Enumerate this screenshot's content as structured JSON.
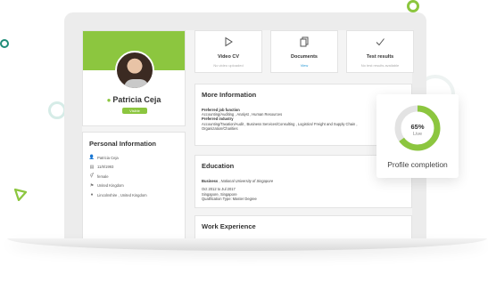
{
  "profile": {
    "name": "Patricia Ceja",
    "status": "Visible",
    "accent": "#8cc63f"
  },
  "personal": {
    "title": "Personal Information",
    "rows": [
      {
        "icon": "person-icon",
        "value": "Patricia Ceja"
      },
      {
        "icon": "calendar-icon",
        "value": "11/8/1993"
      },
      {
        "icon": "gender-icon",
        "value": "female"
      },
      {
        "icon": "flag-icon",
        "value": "United Kingdom"
      },
      {
        "icon": "location-pin-icon",
        "value": "Lincolnshire , United Kingdom"
      }
    ]
  },
  "tiles": {
    "video": {
      "label": "Video CV",
      "sub": "No video uploaded",
      "icon": "play-icon"
    },
    "documents": {
      "label": "Documents",
      "sub": "View",
      "icon": "documents-icon"
    },
    "tests": {
      "label": "Test results",
      "sub": "No test results available",
      "icon": "checkmark-icon"
    }
  },
  "more_info": {
    "title": "More Information",
    "job_function_label": "Preferred job function",
    "job_function_value": "Accounting/Auditing , Analyst , Human Resources",
    "industry_label": "Preferred industry",
    "industry_value": "Accounting/Taxation/Audit , Business Services/Consulting , Logistics/ Freight and Supply Chain ,",
    "industry_value_2": "Organization/Charities"
  },
  "education": {
    "title": "Education",
    "degree_field": "Business",
    "institution": "National University of Singapore",
    "dates": "Oct 2012 to Jul 2017",
    "location": "Singapore, Singapore",
    "qualification": "Qualification Type: Master Degree"
  },
  "work": {
    "title": "Work Experience"
  },
  "completion": {
    "percent_label": "65%",
    "percent": 65,
    "state": "Live",
    "label": "Profile completion",
    "ring_color": "#8cc63f",
    "track_color": "#e3e3e3"
  }
}
